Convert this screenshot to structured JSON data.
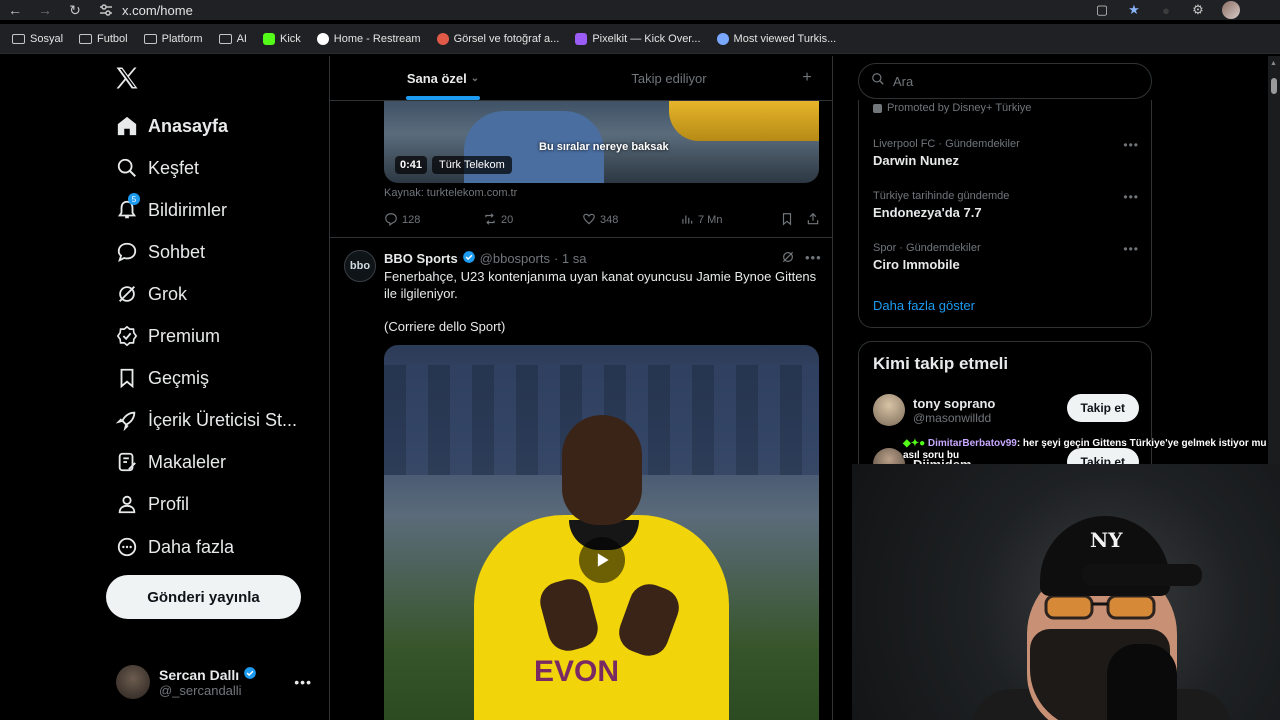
{
  "browser": {
    "url": "x.com/home",
    "bookmarks": [
      {
        "label": "Sosyal",
        "type": "folder"
      },
      {
        "label": "Futbol",
        "type": "folder"
      },
      {
        "label": "Platform",
        "type": "folder"
      },
      {
        "label": "AI",
        "type": "folder"
      },
      {
        "label": "Kick",
        "type": "site",
        "color": "#53fc18"
      },
      {
        "label": "Home - Restream",
        "type": "site",
        "color": "#ffffff"
      },
      {
        "label": "Görsel ve fotoğraf a...",
        "type": "site",
        "color": "#e05a47"
      },
      {
        "label": "Pixelkit — Kick Over...",
        "type": "site",
        "color": "#9b5cf6"
      },
      {
        "label": "Most viewed Turkis...",
        "type": "site",
        "color": "#7aa7ff"
      }
    ]
  },
  "nav": {
    "items": [
      {
        "label": "Anasayfa",
        "icon": "home-icon",
        "active": true
      },
      {
        "label": "Keşfet",
        "icon": "search-icon"
      },
      {
        "label": "Bildirimler",
        "icon": "bell-icon",
        "badge": "5"
      },
      {
        "label": "Sohbet",
        "icon": "chat-icon"
      },
      {
        "label": "Grok",
        "icon": "grok-icon"
      },
      {
        "label": "Premium",
        "icon": "premium-icon"
      },
      {
        "label": "Geçmiş",
        "icon": "bookmark-icon"
      },
      {
        "label": "İçerik Üreticisi St...",
        "icon": "rocket-icon"
      },
      {
        "label": "Makaleler",
        "icon": "article-icon"
      },
      {
        "label": "Profil",
        "icon": "profile-icon"
      },
      {
        "label": "Daha fazla",
        "icon": "more-circle-icon"
      }
    ],
    "post_button": "Gönderi yayınla",
    "account": {
      "name": "Sercan Dallı",
      "handle": "@_sercandalli"
    }
  },
  "feed": {
    "tabs": [
      {
        "label": "Sana özel"
      },
      {
        "label": "Takip ediliyor"
      }
    ],
    "tweet1": {
      "video_caption": "Bu sıralar nereye baksak",
      "duration": "0:41",
      "brand": "Türk Telekom",
      "source": "Kaynak: turktelekom.com.tr",
      "replies": "128",
      "retweets": "20",
      "likes": "348",
      "views": "7 Mn"
    },
    "tweet2": {
      "avatar_text": "bbo",
      "name": "BBO Sports",
      "handle": "@bbosports",
      "time": "· 1 sa",
      "text": "Fenerbahçe, U23 kontenjanıma uyan kanat oyuncusu Jamie Bynoe Gittens ile ilgileniyor.",
      "text2": "(Corriere dello Sport)",
      "sponsor_text": "EVON"
    }
  },
  "sidebar": {
    "search_placeholder": "Ara",
    "promoted": "Promoted by Disney+ Türkiye",
    "trends": [
      {
        "context": "Liverpool FC · Gündemdekiler",
        "title": "Darwin Nunez"
      },
      {
        "context": "Türkiye tarihinde gündemde",
        "title": "Endonezya'da 7.7"
      },
      {
        "context": "Spor · Gündemdekiler",
        "title": "Ciro Immobile"
      }
    ],
    "show_more": "Daha fazla göster",
    "who_to_follow": {
      "title": "Kimi takip etmeli",
      "accounts": [
        {
          "name": "tony soprano",
          "handle": "@masonwilldd",
          "button": "Takip et"
        },
        {
          "name": "Djimidem",
          "handle": "",
          "button": "Takip et"
        }
      ]
    }
  },
  "stream": {
    "chat_user": "DimitarBerbatov99",
    "chat_message": ": her şeyi geçin Gittens Türkiye'ye gelmek istiyor mu asıl soru bu"
  },
  "colors": {
    "accent": "#1d9bf0",
    "bg": "#000000",
    "border": "#2f3336",
    "muted": "#71767b"
  }
}
